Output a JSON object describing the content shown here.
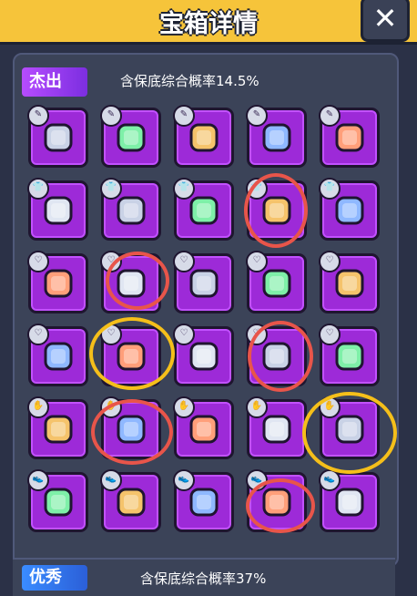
{
  "header": {
    "title": "宝箱详情",
    "close_label": "✕"
  },
  "section_outstanding": {
    "tag": "杰出",
    "rate_text": "含保底综合概率14.5%"
  },
  "items": [
    {
      "icon": "kunai-icon",
      "badge": "✎"
    },
    {
      "icon": "sword-icon",
      "badge": "✎"
    },
    {
      "icon": "revolver-icon",
      "badge": "✎"
    },
    {
      "icon": "shotgun-icon",
      "badge": "✎"
    },
    {
      "icon": "spear-icon",
      "badge": "✎"
    },
    {
      "icon": "leaf-vest-icon",
      "badge": "👕"
    },
    {
      "icon": "spiked-armor-icon",
      "badge": "👕"
    },
    {
      "icon": "green-armor-icon",
      "badge": "👕"
    },
    {
      "icon": "plate-armor-icon",
      "badge": "👕"
    },
    {
      "icon": "blue-armor-icon",
      "badge": "👕"
    },
    {
      "icon": "tooth-necklace-icon",
      "badge": "♡"
    },
    {
      "icon": "spike-collar-icon",
      "badge": "♡"
    },
    {
      "icon": "emerald-necklace-icon",
      "badge": "♡"
    },
    {
      "icon": "pendant-necklace-icon",
      "badge": "♡"
    },
    {
      "icon": "shield-necklace-icon",
      "badge": "♡"
    },
    {
      "icon": "rope-belt-icon",
      "badge": "♡"
    },
    {
      "icon": "star-belt-icon",
      "badge": "♡"
    },
    {
      "icon": "emerald-belt-icon",
      "badge": "♡"
    },
    {
      "icon": "gold-belt-icon",
      "badge": "♡"
    },
    {
      "icon": "tech-belt-icon",
      "badge": "♡"
    },
    {
      "icon": "fur-glove-icon",
      "badge": "✋"
    },
    {
      "icon": "metal-glove-icon",
      "badge": "✋"
    },
    {
      "icon": "green-glove-icon",
      "badge": "✋"
    },
    {
      "icon": "gold-glove-icon",
      "badge": "✋"
    },
    {
      "icon": "blue-glove-icon",
      "badge": "✋"
    },
    {
      "icon": "claw-boot-icon",
      "badge": "👟"
    },
    {
      "icon": "steel-boot-icon",
      "badge": "👟"
    },
    {
      "icon": "green-boot-icon",
      "badge": "👟"
    },
    {
      "icon": "pink-sneaker-icon",
      "badge": "👟"
    },
    {
      "icon": "mech-boot-icon",
      "badge": "👟"
    }
  ],
  "section_excellent": {
    "tag": "优秀",
    "rate_text": "含保底综合概率37%"
  },
  "colors": {
    "header_bg": "#f6c43a",
    "cell_bg": "#9d2ad8",
    "panel_bg": "#3b4358",
    "red_marker": "#e8554a",
    "yellow_marker": "#f5bf1a"
  }
}
